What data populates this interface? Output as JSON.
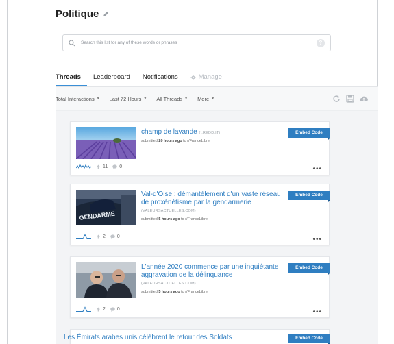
{
  "list": {
    "title": "Politique"
  },
  "search": {
    "placeholder": "Search this list for any of these words or phrases",
    "help_label": "?"
  },
  "tabs": [
    {
      "label": "Threads",
      "active": true
    },
    {
      "label": "Leaderboard",
      "active": false
    },
    {
      "label": "Notifications",
      "active": false
    },
    {
      "label": "Manage",
      "active": false,
      "disabled": true
    }
  ],
  "filters": [
    {
      "label": "Total Interactions"
    },
    {
      "label": "Last 72 Hours"
    },
    {
      "label": "All Threads"
    },
    {
      "label": "More"
    }
  ],
  "filter_icons": [
    "refresh-icon",
    "save-icon",
    "cloud-upload-icon"
  ],
  "colors": {
    "accent": "#2f7ec1",
    "tab_underline": "#3a8fd6",
    "feed_background": "#f3f4f6"
  },
  "threads": [
    {
      "title": "champ de lavande",
      "domain": "(i.redd.it)",
      "submitted_prefix": "submitted",
      "time": "20 hours ago",
      "to": "to r/FranceLibre",
      "upvotes": "11",
      "comments": "0",
      "embed_label": "Embed Code",
      "thumb": "lavender-field-thumbnail"
    },
    {
      "title": "Val-d'Oise : démantèlement d'un vaste réseau de proxénétisme par la gendarmerie",
      "domain": "(valeursactuelles.com)",
      "submitted_prefix": "submitted",
      "time": "5 hours ago",
      "to": "to r/FranceLibre",
      "upvotes": "2",
      "comments": "0",
      "embed_label": "Embed Code",
      "thumb": "gendarmerie-thumbnail",
      "thumb_text": "GENDARME"
    },
    {
      "title": "L'année 2020 commence par une inquiétante aggravation de la délinquance",
      "domain": "(valeursactuelles.com)",
      "submitted_prefix": "submitted",
      "time": "5 hours ago",
      "to": "to r/FranceLibre",
      "upvotes": "2",
      "comments": "0",
      "embed_label": "Embed Code",
      "thumb": "officials-thumbnail"
    },
    {
      "title": "Les Émirats arabes unis célèbrent le retour des Soldats",
      "embed_label": "Embed Code"
    }
  ],
  "more_label": "•••"
}
